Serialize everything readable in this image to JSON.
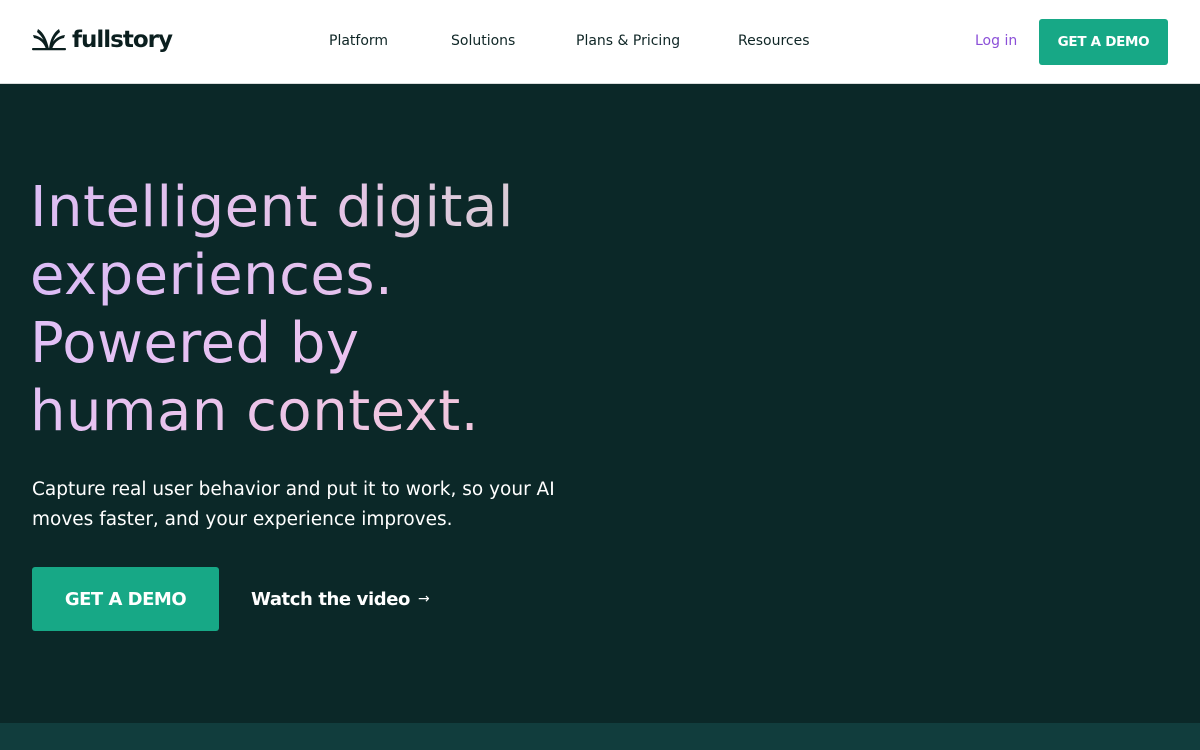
{
  "brand": {
    "name": "fullstory",
    "accent": "#17a886",
    "login_color": "#8b4fd8",
    "hero_bg": "#0b2828"
  },
  "nav": {
    "items": [
      {
        "label": "Platform"
      },
      {
        "label": "Solutions"
      },
      {
        "label": "Plans & Pricing"
      },
      {
        "label": "Resources"
      }
    ],
    "login_label": "Log in",
    "demo_label": "GET A DEMO"
  },
  "hero": {
    "headline_lines": [
      "Intelligent digital",
      "experiences.",
      "Powered by",
      "human context."
    ],
    "subhead": "Capture real user behavior and put it to work, so your AI moves faster, and your experience improves.",
    "primary_cta": "GET A DEMO",
    "secondary_cta": "Watch the video",
    "secondary_cta_icon": "arrow-right-icon"
  }
}
